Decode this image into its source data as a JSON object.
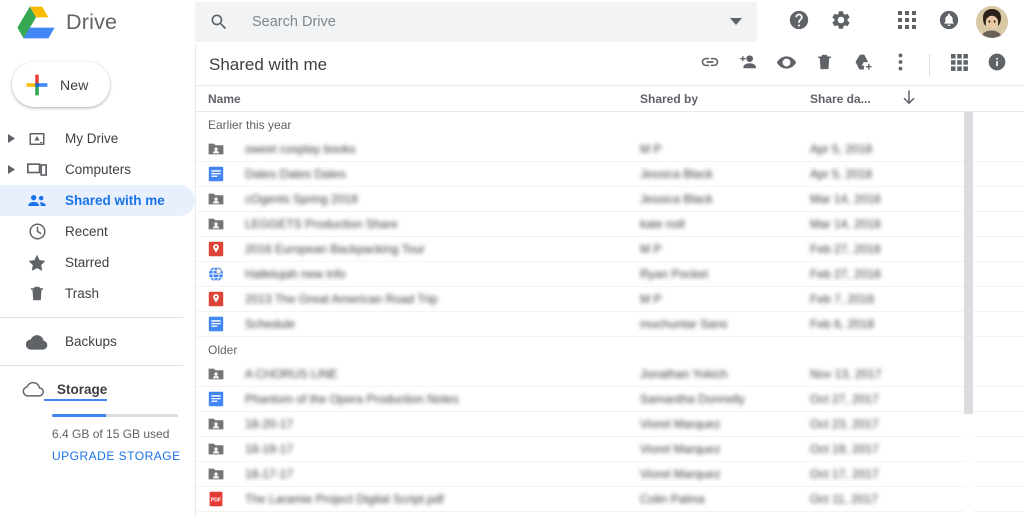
{
  "brand": {
    "name": "Drive",
    "logo_icon": "google-drive-logo"
  },
  "search": {
    "placeholder": "Search Drive",
    "value": "",
    "icon": "search-icon",
    "dropdown_icon": "chevron-down-icon"
  },
  "topbar_actions": [
    {
      "name": "help-button",
      "icon": "help-icon",
      "label": "Support"
    },
    {
      "name": "settings-button",
      "icon": "gear-icon",
      "label": "Settings"
    },
    {
      "name": "apps-button",
      "icon": "grid-apps-icon",
      "label": "Google apps"
    },
    {
      "name": "notifications-button",
      "icon": "bell-icon",
      "label": "Notifications"
    },
    {
      "name": "account-avatar",
      "icon": "avatar-icon",
      "label": "Google Account"
    }
  ],
  "sidebar": {
    "new_button": {
      "label": "New",
      "icon": "plus-icon"
    },
    "items": [
      {
        "label": "My Drive",
        "icon": "my-drive-icon",
        "expandable": true,
        "active": false
      },
      {
        "label": "Computers",
        "icon": "computers-icon",
        "expandable": true,
        "active": false
      },
      {
        "label": "Shared with me",
        "icon": "people-icon",
        "expandable": false,
        "active": true
      },
      {
        "label": "Recent",
        "icon": "clock-icon",
        "expandable": false,
        "active": false
      },
      {
        "label": "Starred",
        "icon": "star-icon",
        "expandable": false,
        "active": false
      },
      {
        "label": "Trash",
        "icon": "trash-icon",
        "expandable": false,
        "active": false
      },
      {
        "label": "Backups",
        "icon": "cloud-filled-icon",
        "expandable": false,
        "active": false
      }
    ],
    "storage": {
      "label": "Storage",
      "icon": "cloud-outline-icon",
      "used_text": "6.4 GB of 15 GB used",
      "percent_used": 43,
      "upgrade_label": "UPGRADE STORAGE"
    }
  },
  "colors": {
    "accent": "#1a73e8",
    "active_bg": "#e8f0fe",
    "text": "#3c4043",
    "muted": "#5f6368",
    "docs_blue": "#4285f4",
    "maps_red": "#db4437",
    "pdf_red": "#e53935",
    "folder_gray": "#757575"
  },
  "main": {
    "page_title": "Shared with me",
    "toolbar": [
      {
        "name": "get-link-button",
        "icon": "link-icon"
      },
      {
        "name": "share-button",
        "icon": "person-add-icon"
      },
      {
        "name": "preview-button",
        "icon": "eye-icon"
      },
      {
        "name": "remove-button",
        "icon": "trash-icon"
      },
      {
        "name": "add-to-drive-button",
        "icon": "drive-add-icon"
      },
      {
        "name": "more-actions-button",
        "icon": "more-vertical-icon"
      },
      {
        "name": "grid-view-button",
        "icon": "grid-view-icon"
      },
      {
        "name": "details-button",
        "icon": "info-icon"
      }
    ],
    "columns": {
      "name": "Name",
      "shared_by": "Shared by",
      "share_date": "Share da...",
      "sort_icon": "arrow-down-icon"
    },
    "groups": [
      {
        "label": "Earlier this year",
        "rows": [
          {
            "icon": "shared-folder-icon",
            "name": "sweet cosplay books",
            "shared_by": "M P",
            "share_date": "Apr 5, 2018"
          },
          {
            "icon": "google-docs-icon",
            "name": "Dates Dates Dates",
            "shared_by": "Jessica Black",
            "share_date": "Apr 5, 2018"
          },
          {
            "icon": "shared-folder-icon",
            "name": "cOgents Spring 2018",
            "shared_by": "Jessica Black",
            "share_date": "Mar 14, 2018"
          },
          {
            "icon": "shared-folder-icon",
            "name": "LEGGETS Production Share",
            "shared_by": "kate noll",
            "share_date": "Mar 14, 2018"
          },
          {
            "icon": "google-maps-icon",
            "name": "2016 European Backpacking Tour",
            "shared_by": "M P",
            "share_date": "Feb 27, 2018"
          },
          {
            "icon": "web-link-icon",
            "name": "Hallelujah new info",
            "shared_by": "Ryan Pocket",
            "share_date": "Feb 27, 2018"
          },
          {
            "icon": "google-maps-icon",
            "name": "2013 The Great American Road Trip",
            "shared_by": "M P",
            "share_date": "Feb 7, 2018"
          },
          {
            "icon": "google-docs-icon",
            "name": "Schedule",
            "shared_by": "muchuntar Sans",
            "share_date": "Feb 6, 2018"
          }
        ]
      },
      {
        "label": "Older",
        "rows": [
          {
            "icon": "shared-folder-icon",
            "name": "A CHORUS LINE",
            "shared_by": "Jonathan Yokich",
            "share_date": "Nov 13, 2017"
          },
          {
            "icon": "google-docs-icon",
            "name": "Phantom of the Opera Production Notes",
            "shared_by": "Samantha Donnelly",
            "share_date": "Oct 27, 2017"
          },
          {
            "icon": "shared-folder-icon",
            "name": "18-20-17",
            "shared_by": "Viorel Marquez",
            "share_date": "Oct 23, 2017"
          },
          {
            "icon": "shared-folder-icon",
            "name": "18-19-17",
            "shared_by": "Viorel Marquez",
            "share_date": "Oct 19, 2017"
          },
          {
            "icon": "shared-folder-icon",
            "name": "18-17-17",
            "shared_by": "Viorel Marquez",
            "share_date": "Oct 17, 2017"
          },
          {
            "icon": "pdf-icon",
            "name": "The Laramie Project Digital Script.pdf",
            "shared_by": "Colin Palma",
            "share_date": "Oct 11, 2017"
          }
        ]
      }
    ]
  }
}
